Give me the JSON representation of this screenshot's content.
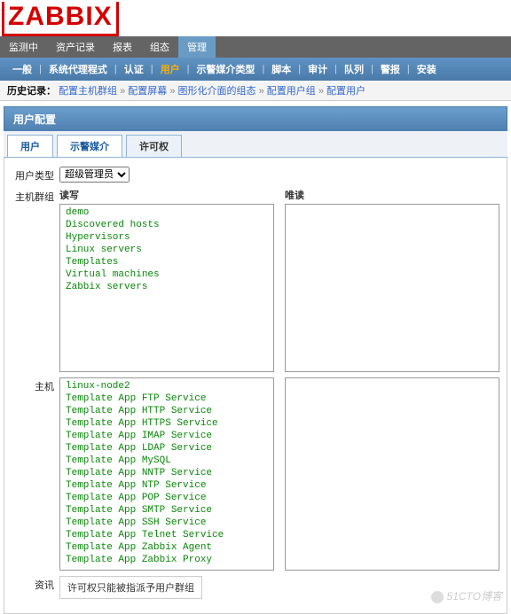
{
  "logo": "ZABBIX",
  "nav1": {
    "items": [
      "监测中",
      "资产记录",
      "报表",
      "组态",
      "管理"
    ],
    "active_index": 4
  },
  "nav2": {
    "items": [
      "一般",
      "系统代理程式",
      "认证",
      "用户",
      "示警媒介类型",
      "脚本",
      "审计",
      "队列",
      "警报",
      "安装"
    ],
    "active_index": 3
  },
  "history": {
    "label": "历史记录：",
    "items": [
      "配置主机群组",
      "配置屏幕",
      "图形化介面的组态",
      "配置用户组",
      "配置用户"
    ]
  },
  "page_header": "用户配置",
  "tabs": {
    "items": [
      "用户",
      "示警媒介",
      "许可权"
    ],
    "active_index": 2
  },
  "form": {
    "user_type_label": "用户类型",
    "user_type_value": "超级管理员",
    "host_group_label": "主机群组",
    "hosts_label": "主机",
    "rw_label": "读写",
    "ro_label": "唯读",
    "info_label": "资讯",
    "info_text": "许可权只能被指派予用户群组"
  },
  "host_groups_rw": [
    "demo",
    "Discovered hosts",
    "Hypervisors",
    "Linux servers",
    "Templates",
    "Virtual machines",
    "Zabbix servers"
  ],
  "host_groups_ro": [],
  "hosts_rw": [
    "linux-node2",
    "Template App FTP Service",
    "Template App HTTP Service",
    "Template App HTTPS Service",
    "Template App IMAP Service",
    "Template App LDAP Service",
    "Template App MySQL",
    "Template App NNTP Service",
    "Template App NTP Service",
    "Template App POP Service",
    "Template App SMTP Service",
    "Template App SSH Service",
    "Template App Telnet Service",
    "Template App Zabbix Agent",
    "Template App Zabbix Proxy"
  ],
  "hosts_ro": [],
  "watermark": "51CTO博客"
}
